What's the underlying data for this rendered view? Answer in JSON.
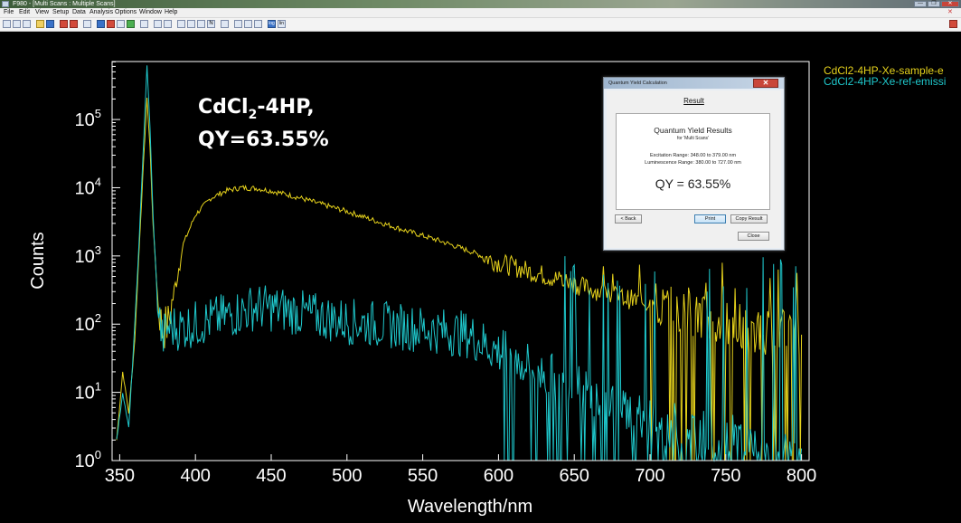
{
  "window": {
    "title": "F980 - [Multi Scans : Multiple Scans]",
    "controls": [
      "—",
      "❐",
      "✕"
    ]
  },
  "menu": [
    "File",
    "Edit",
    "View",
    "Setup",
    "Data",
    "Analysis",
    "Options",
    "Window",
    "Help"
  ],
  "toolbar_icons": [
    "file-icon",
    "lambda-icon",
    "export-icon",
    "open-folder-icon",
    "save-icon",
    "scan-icon",
    "scan-stop-icon",
    "print-icon",
    "chart-icon",
    "record-icon",
    "marker-icon",
    "measure-icon",
    "camera-icon",
    "zoom-in-icon",
    "zoom-out-icon",
    "bar-chart-icon",
    "table-icon",
    "graph-icon",
    "normalize-icon",
    "copy-icon",
    "peak-icon",
    "fit-icon",
    "log-icon",
    "lin-icon"
  ],
  "toolbar_labels": {
    "n": "N",
    "log": "log",
    "lin": "lin"
  },
  "annotation": {
    "line1_main": "CdCl",
    "line1_sub": "2",
    "line1_rest": "-4HP,",
    "line2": "QY=63.55%"
  },
  "legend": [
    {
      "label": "CdCl2-4HP-Xe-sample-e",
      "color": "#e6d21c"
    },
    {
      "label": "CdCl2-4HP-Xe-ref-emissi",
      "color": "#1fc8cc"
    }
  ],
  "dialog": {
    "title": "Quantum Yield Calculation",
    "close_label": "✕",
    "result_label": "Result",
    "heading": "Quantum Yield Results",
    "subheading": "for 'Multi Scans'",
    "excitation": "Excitation Range: 348.00 to 379.00 nm",
    "luminescence": "Luminescence Range: 380.00 to 727.00 nm",
    "qy": "QY = 63.55%",
    "buttons": {
      "back": "< Back",
      "print": "Print",
      "copy": "Copy Result",
      "close": "Close"
    }
  },
  "chart_data": {
    "type": "line",
    "xlabel": "Wavelength/nm",
    "ylabel": "Counts",
    "xlim": [
      345,
      805
    ],
    "ylim_log10": [
      0,
      5.85
    ],
    "yscale": "log",
    "x_ticks": [
      350,
      400,
      450,
      500,
      550,
      600,
      650,
      700,
      750,
      800
    ],
    "y_ticks": [
      {
        "base": "10",
        "exp": "0",
        "value": 1
      },
      {
        "base": "10",
        "exp": "1",
        "value": 10
      },
      {
        "base": "10",
        "exp": "2",
        "value": 100
      },
      {
        "base": "10",
        "exp": "3",
        "value": 1000
      },
      {
        "base": "10",
        "exp": "4",
        "value": 10000
      },
      {
        "base": "10",
        "exp": "5",
        "value": 100000
      }
    ],
    "series": [
      {
        "name": "CdCl2-4HP-Xe-sample-e",
        "color": "#e6d21c",
        "x": [
          348,
          352,
          356,
          360,
          363,
          366,
          368,
          370,
          372,
          375,
          378,
          382,
          386,
          392,
          400,
          410,
          420,
          430,
          440,
          450,
          460,
          470,
          480,
          500,
          520,
          540,
          560,
          580,
          600,
          620,
          640,
          660,
          680,
          700,
          720,
          740,
          760,
          780,
          800
        ],
        "y": [
          2,
          20,
          5,
          60,
          1500,
          30000,
          200000,
          40000,
          3000,
          250,
          80,
          100,
          300,
          1500,
          4000,
          7000,
          9000,
          10000,
          9800,
          9000,
          8000,
          7000,
          6000,
          4500,
          3200,
          2300,
          1700,
          1200,
          800,
          600,
          450,
          330,
          250,
          200,
          150,
          110,
          90,
          75,
          70
        ]
      },
      {
        "name": "CdCl2-4HP-Xe-ref-emissi",
        "color": "#1fc8cc",
        "x": [
          348,
          352,
          356,
          360,
          363,
          366,
          368,
          370,
          372,
          375,
          378,
          382,
          390,
          400,
          420,
          440,
          460,
          480,
          500,
          520,
          540,
          560,
          580,
          600,
          620,
          640,
          660,
          680,
          700,
          720,
          740,
          760,
          780,
          800
        ],
        "y": [
          2,
          10,
          3,
          100,
          2000,
          60000,
          600000,
          80000,
          4000,
          200,
          60,
          90,
          90,
          100,
          130,
          180,
          160,
          130,
          110,
          100,
          90,
          80,
          70,
          40,
          25,
          15,
          10,
          6,
          4,
          3,
          2.5,
          2,
          1.5,
          1.5
        ]
      }
    ]
  }
}
